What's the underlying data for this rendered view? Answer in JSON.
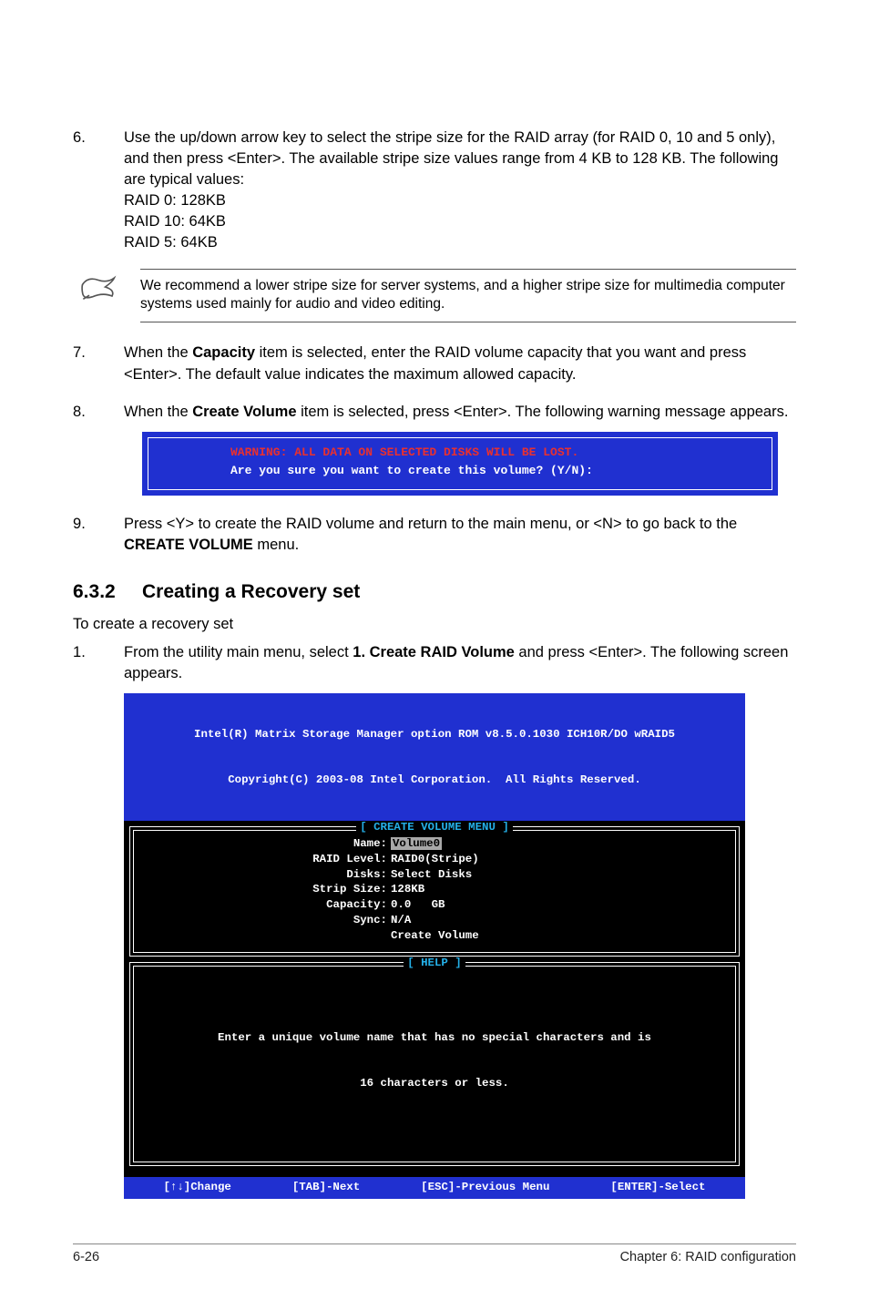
{
  "steps_first": {
    "item6": {
      "main": "Use the up/down arrow key to select the stripe size for the RAID array (for RAID 0, 10 and 5 only), and then press <Enter>. The available stripe size values range from 4 KB to 128 KB. The following are typical values:",
      "l1": "RAID 0: 128KB",
      "l2": "RAID 10: 64KB",
      "l3": "RAID 5: 64KB"
    }
  },
  "note": {
    "text": "We recommend a lower stripe size for server systems, and a higher stripe size for multimedia computer systems used mainly for audio and video editing."
  },
  "steps_cont": {
    "item7": {
      "pre": "When the ",
      "bold": "Capacity",
      "post": " item is selected, enter the RAID volume capacity that you want and press <Enter>. The default value indicates the maximum allowed capacity."
    },
    "item8": {
      "pre": "When the ",
      "bold": "Create Volume",
      "post": " item is selected, press <Enter>. The following warning message appears."
    },
    "item9": {
      "pre": "Press <Y> to create the RAID volume and return to the main menu, or <N> to go back to the ",
      "bold": "CREATE VOLUME",
      "post": " menu."
    }
  },
  "warning_box": {
    "line1": "WARNING: ALL DATA ON SELECTED DISKS WILL BE LOST.",
    "line2": "Are you sure you want to create this volume? (Y/N):"
  },
  "section": {
    "num": "6.3.2",
    "title": "Creating a Recovery set"
  },
  "intro": "To create a recovery set",
  "steps2": {
    "item1": {
      "pre": "From the utility main menu, select ",
      "bold": "1. Create RAID Volume",
      "post": " and press <Enter>. The following screen appears."
    }
  },
  "bios": {
    "header_l1": "Intel(R) Matrix Storage Manager option ROM v8.5.0.1030 ICH10R/DO wRAID5",
    "header_l2": "Copyright(C) 2003-08 Intel Corporation.  All Rights Reserved.",
    "panel1_title": "[ CREATE VOLUME MENU ]",
    "menu": {
      "name_label": "Name:",
      "name_value": "Volume0",
      "raid_label": "RAID Level:",
      "raid_value": "RAID0(Stripe)",
      "disks_label": "Disks:",
      "disks_value": "Select Disks",
      "strip_label": "Strip Size:",
      "strip_value": "128KB",
      "cap_label": "Capacity:",
      "cap_value": "0.0   GB",
      "sync_label": "Sync:",
      "sync_value": "N/A",
      "create_label": "",
      "create_value": "Create Volume"
    },
    "panel2_title": "[ HELP ]",
    "help_l1": "Enter a unique volume name that has no special characters and is",
    "help_l2": "16 characters or less.",
    "footer": {
      "k1": "[↑↓]Change",
      "k2": "[TAB]-Next",
      "k3": "[ESC]-Previous Menu",
      "k4": "[ENTER]-Select"
    }
  },
  "footer": {
    "left": "6-26",
    "right": "Chapter 6: RAID configuration"
  }
}
